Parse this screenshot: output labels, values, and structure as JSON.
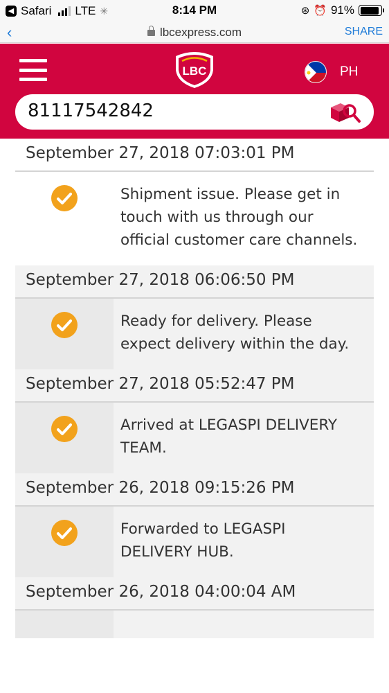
{
  "status_bar": {
    "back_app": "Safari",
    "carrier": "LTE",
    "time": "8:14 PM",
    "battery": "91%"
  },
  "browser": {
    "url": "lbcexpress.com",
    "share_label": "SHARE"
  },
  "header": {
    "logo_text": "LBC",
    "country": "PH",
    "brand_color": "#d1053f"
  },
  "search": {
    "tracking_number": "81117542842"
  },
  "timeline": [
    {
      "date": "September 27, 2018 07:03:01 PM",
      "status": "Shipment issue. Please get in touch with us through our official customer care channels."
    },
    {
      "date": "September 27, 2018 06:06:50 PM",
      "status": "Ready for delivery. Please expect delivery within the day."
    },
    {
      "date": "September 27, 2018 05:52:47 PM",
      "status": "Arrived at LEGASPI DELIVERY TEAM."
    },
    {
      "date": "September 26, 2018 09:15:26 PM",
      "status": "Forwarded to LEGASPI DELIVERY HUB."
    },
    {
      "date": "September 26, 2018 04:00:04 AM",
      "status": ""
    }
  ],
  "icons": {
    "status": "check-circle-icon",
    "accent": "#f2a21c"
  }
}
